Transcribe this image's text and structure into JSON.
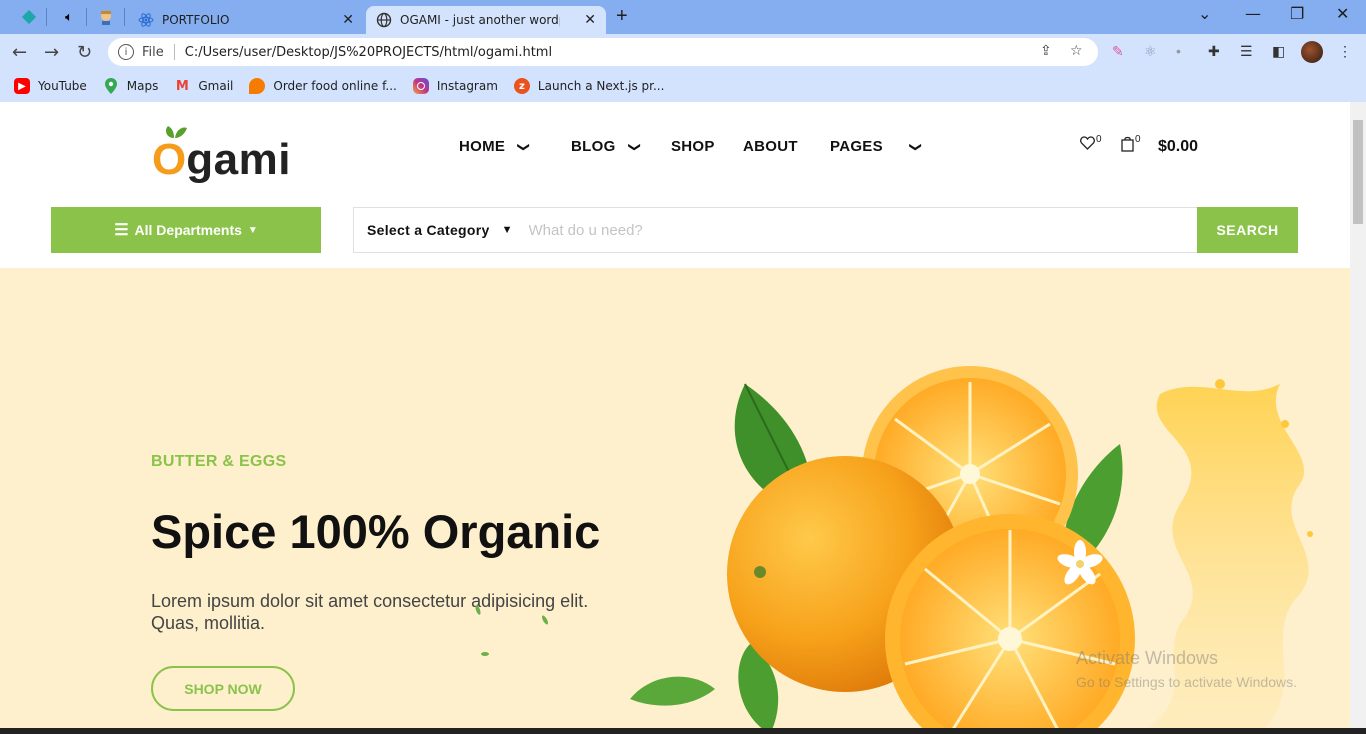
{
  "browser": {
    "tabs": [
      {
        "title": "PORTFOLIO"
      },
      {
        "title": "OGAMI - just another wordpress"
      }
    ],
    "address": {
      "scheme": "File",
      "url": "C:/Users/user/Desktop/JS%20PROJECTS/html/ogami.html"
    },
    "bookmarks": [
      {
        "label": "YouTube",
        "color": "#ff0000"
      },
      {
        "label": "Maps",
        "color": "#34a853"
      },
      {
        "label": "Gmail",
        "color": "#ea4335"
      },
      {
        "label": "Order food online f...",
        "color": "#f57c00"
      },
      {
        "label": "Instagram",
        "color": "#c13584"
      },
      {
        "label": "Launch a Next.js pr...",
        "color": "#e8531f"
      }
    ]
  },
  "site": {
    "logo": {
      "first": "O",
      "rest": "gami"
    },
    "nav": {
      "home": "HOME",
      "blog": "BLOG",
      "shop": "SHOP",
      "about": "ABOUT",
      "pages": "PAGES"
    },
    "header": {
      "wishlist_count": "0",
      "cart_count": "0",
      "cart_total": "$0.00"
    },
    "departments_label": "All Departments",
    "search": {
      "category": "Select a Category",
      "placeholder": "What do u need?",
      "button": "SEARCH"
    },
    "hero": {
      "eyebrow": "BUTTER & EGGS",
      "headline": "Spice 100% Organic",
      "subtext": "Lorem ipsum dolor sit amet consectetur adipisicing elit. Quas, mollitia.",
      "cta": "SHOP NOW"
    },
    "watermark": {
      "line1": "Activate Windows",
      "line2": "Go to Settings to activate Windows."
    },
    "colors": {
      "accent": "#8bc34a",
      "logo_orange": "#f59c1a",
      "hero_bg": "#fef0cd"
    }
  }
}
